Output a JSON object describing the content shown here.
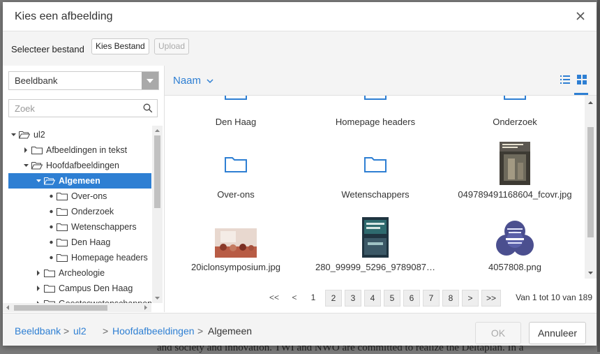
{
  "dialog": {
    "title": "Kies een afbeelding"
  },
  "select_bar": {
    "label": "Selecteer bestand",
    "choose_label": "Kies Bestand",
    "upload_label": "Upload"
  },
  "source": {
    "selected": "Beeldbank"
  },
  "search": {
    "placeholder": "Zoek"
  },
  "tree": [
    {
      "label": "ul2",
      "state": "open"
    },
    {
      "label": "Afbeeldingen in tekst",
      "state": "closed"
    },
    {
      "label": "Hoofdafbeeldingen",
      "state": "open"
    },
    {
      "label": "Algemeen",
      "state": "open",
      "selected": true
    },
    {
      "label": "Over-ons",
      "state": "leaf"
    },
    {
      "label": "Onderzoek",
      "state": "leaf"
    },
    {
      "label": "Wetenschappers",
      "state": "leaf"
    },
    {
      "label": "Den Haag",
      "state": "leaf"
    },
    {
      "label": "Homepage headers",
      "state": "leaf"
    },
    {
      "label": "Archeologie",
      "state": "closed"
    },
    {
      "label": "Campus Den Haag",
      "state": "closed"
    },
    {
      "label": "Geesteswetenschappen",
      "state": "closed"
    }
  ],
  "sort": {
    "label": "Naam"
  },
  "items": [
    {
      "caption": "Den Haag",
      "kind": "folder"
    },
    {
      "caption": "Homepage headers",
      "kind": "folder"
    },
    {
      "caption": "Onderzoek",
      "kind": "folder"
    },
    {
      "caption": "Over-ons",
      "kind": "folder"
    },
    {
      "caption": "Wetenschappers",
      "kind": "folder"
    },
    {
      "caption": "049789491168604_fcovr.jpg",
      "kind": "image"
    },
    {
      "caption": "20iclonsymposium.jpg",
      "kind": "image"
    },
    {
      "caption": "280_99999_5296_9789087…",
      "kind": "image"
    },
    {
      "caption": "4057808.png",
      "kind": "image"
    }
  ],
  "pager": {
    "first": "<<",
    "prev": "<",
    "pages": [
      "1",
      "2",
      "3",
      "4",
      "5",
      "6",
      "7",
      "8"
    ],
    "next": ">",
    "last": ">>",
    "current": "1",
    "info": "Van 1 tot 10 van 189"
  },
  "breadcrumb": {
    "items": [
      "Beeldbank",
      "ul2",
      "Hoofdafbeeldingen",
      "Algemeen"
    ],
    "sep": ">"
  },
  "footer": {
    "ok_label": "OK",
    "cancel_label": "Annuleer"
  },
  "colors": {
    "accent": "#2e7fd3"
  },
  "backdrop": {
    "text": "and society and innovation. TWI and NWO are committed to realize the Deltaplan. In a"
  }
}
